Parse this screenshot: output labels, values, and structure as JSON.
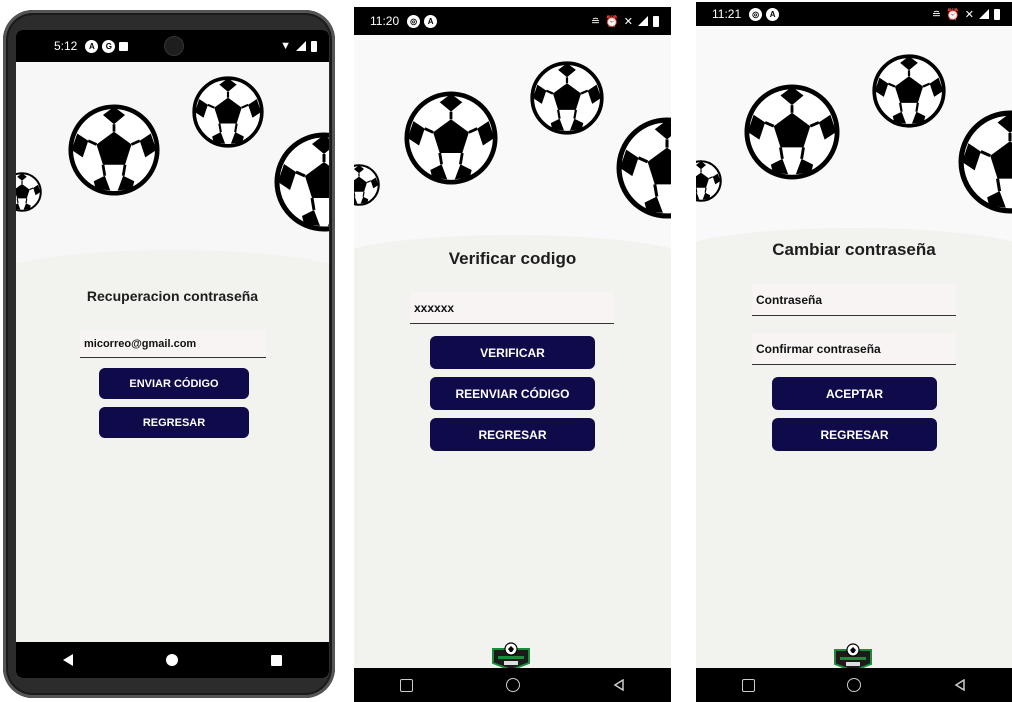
{
  "screen1": {
    "status": {
      "time": "5:12"
    },
    "title": "Recuperacion contraseña",
    "email_value": "micorreo@gmail.com",
    "send_button": "ENVIAR CÓDIGO",
    "back_button": "REGRESAR"
  },
  "screen2": {
    "status": {
      "time": "11:20"
    },
    "title": "Verificar codigo",
    "code_value": "xxxxxx",
    "verify_button": "VERIFICAR",
    "resend_button": "REENVIAR CÓDIGO",
    "back_button": "REGRESAR"
  },
  "screen3": {
    "status": {
      "time": "11:21"
    },
    "title": "Cambiar contraseña",
    "password_placeholder": "Contraseña",
    "confirm_placeholder": "Confirmar contraseña",
    "accept_button": "ACEPTAR",
    "back_button": "REGRESAR"
  },
  "colors": {
    "button_bg": "#0f0a4a",
    "panel_bg": "#f2f2ee",
    "logo_green": "#1b8c3a"
  }
}
